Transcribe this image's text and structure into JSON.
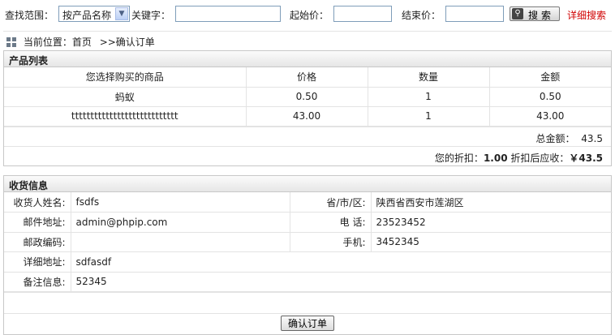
{
  "search": {
    "scope_label": "查找范围：",
    "scope_selected": "按产品名称",
    "keyword_label": "关键字：",
    "keyword_value": "",
    "start_price_label": "起始价：",
    "start_price_value": "",
    "end_price_label": "结束价：",
    "end_price_value": "",
    "search_button": "搜索",
    "advanced_link": "详细搜索"
  },
  "breadcrumb": {
    "current_label": "当前位置：",
    "home": "首页",
    "separator": ">>",
    "page": "确认订单"
  },
  "products": {
    "title": "产品列表",
    "columns": [
      "您选择购买的商品",
      "价格",
      "数量",
      "金额"
    ],
    "rows": [
      {
        "name": "蚂蚁",
        "price": "0.50",
        "qty": "1",
        "amount": "0.50"
      },
      {
        "name": "tttttttttttttttttttttttttttt",
        "price": "43.00",
        "qty": "1",
        "amount": "43.00"
      }
    ],
    "total_label": "总金额：",
    "total_value": "43.5",
    "discount_label": "您的折扣：",
    "discount_value": "1.00",
    "after_discount_label": "折扣后应收：",
    "after_discount_value": "￥43.5"
  },
  "shipping": {
    "title": "收货信息",
    "name_label": "收货人姓名:",
    "name_value": "fsdfs",
    "region_label": "省/市/区:",
    "region_value": "陕西省西安市莲湖区",
    "email_label": "邮件地址:",
    "email_value": "admin@phpip.com",
    "phone_label": "电 话:",
    "phone_value": "23523452",
    "zip_label": "邮政编码:",
    "zip_value": "",
    "mobile_label": "手机:",
    "mobile_value": "3452345",
    "address_label": "详细地址:",
    "address_value": "sdfasdf",
    "note_label": "备注信息:",
    "note_value": "52345"
  },
  "confirm_button": "确认订单"
}
